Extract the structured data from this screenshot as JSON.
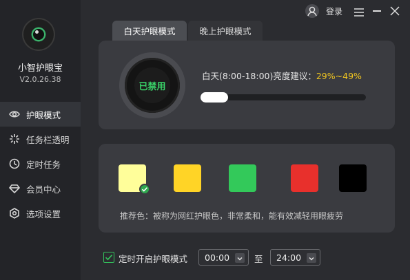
{
  "app": {
    "name": "小智护眼宝",
    "version": "V2.0.26.38"
  },
  "topbar": {
    "login_label": "登录"
  },
  "sidebar": {
    "items": [
      {
        "label": "护眼模式",
        "icon": "eye-icon"
      },
      {
        "label": "任务栏透明",
        "icon": "sparkle-icon"
      },
      {
        "label": "定时任务",
        "icon": "clock-icon"
      },
      {
        "label": "会员中心",
        "icon": "diamond-icon"
      },
      {
        "label": "选项设置",
        "icon": "settings-icon"
      }
    ]
  },
  "tabs": [
    {
      "label": "白天护眼模式"
    },
    {
      "label": "晚上护眼模式"
    }
  ],
  "status": {
    "label": "已禁用",
    "color": "#3ad56a"
  },
  "brightness": {
    "prefix": "白天(8:00-18:00)亮度建议：",
    "value": "29%~49%",
    "slider_fraction": 0.0
  },
  "colors": {
    "swatches": [
      "#fffe9a",
      "#ffd426",
      "#33c95a",
      "#e8302c",
      "#000000"
    ],
    "selected_index": 0,
    "recommend_text": "推荐色：被称为网红护眼色，非常柔和，能有效减轻用眼疲劳"
  },
  "timer": {
    "label": "定时开启护眼模式",
    "checked": true,
    "start": "00:00",
    "separator": "至",
    "end": "24:00"
  },
  "accent": "#33c35c"
}
